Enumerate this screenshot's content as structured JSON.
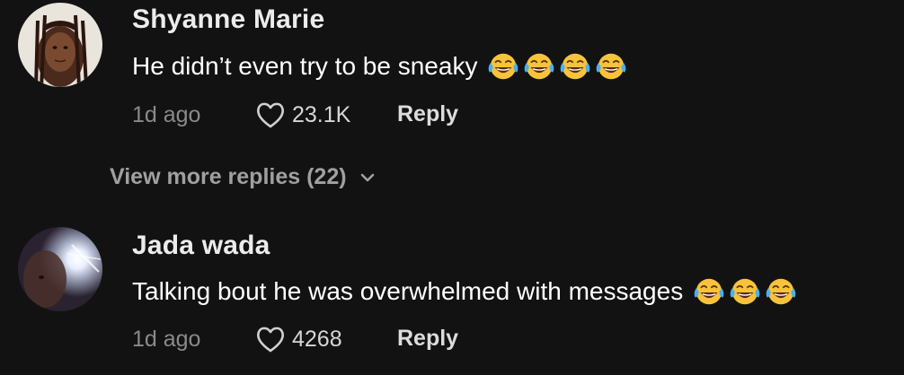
{
  "comments": [
    {
      "username": "Shyanne Marie",
      "text": "He didn’t even try to be sneaky",
      "emoji": [
        "face-with-tears-of-joy",
        "face-with-tears-of-joy",
        "face-with-tears-of-joy",
        "face-with-tears-of-joy"
      ],
      "timestamp": "1d ago",
      "likes": "23.1K",
      "reply_label": "Reply",
      "avatar_icon": "avatar-photo"
    },
    {
      "username": "Jada wada",
      "text": "Talking bout he was overwhelmed with messages",
      "emoji": [
        "face-with-tears-of-joy",
        "face-with-tears-of-joy",
        "face-with-tears-of-joy"
      ],
      "timestamp": "1d ago",
      "likes": "4268",
      "reply_label": "Reply",
      "avatar_icon": "avatar-photo"
    }
  ],
  "view_more": {
    "label": "View more replies (22)",
    "icon": "chevron-down-icon"
  },
  "colors": {
    "background": "#121212",
    "username": "#ececec",
    "text": "#ffffff",
    "muted": "#8a8a8a",
    "emoji_face": "#f7c33a"
  }
}
